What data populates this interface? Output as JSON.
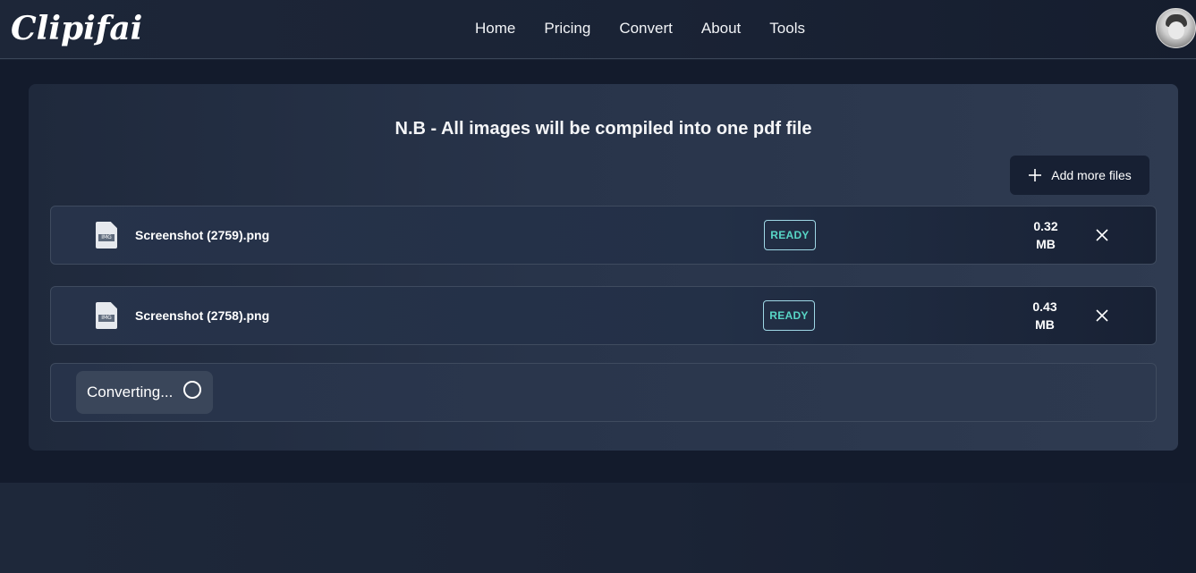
{
  "header": {
    "logo": "Clipifai",
    "nav": [
      "Home",
      "Pricing",
      "Convert",
      "About",
      "Tools"
    ]
  },
  "main": {
    "notice": "N.B - All images will be compiled into one pdf file",
    "add_button_label": "Add more files",
    "files": [
      {
        "name": "Screenshot (2759).png",
        "status": "READY",
        "size_value": "0.32",
        "size_unit": "MB",
        "icon_tag": "IMG"
      },
      {
        "name": "Screenshot (2758).png",
        "status": "READY",
        "size_value": "0.43",
        "size_unit": "MB",
        "icon_tag": "IMG"
      }
    ],
    "convert_label": "Converting..."
  },
  "colors": {
    "accent_ready_text": "#58d6c6",
    "accent_ready_border": "#9fd8e6",
    "background": "#131b2c",
    "card": "#28344a"
  },
  "icons": {
    "add": "plus-icon",
    "file": "image-file-icon",
    "remove": "close-icon",
    "loading": "spinner-icon",
    "profile": "avatar"
  }
}
